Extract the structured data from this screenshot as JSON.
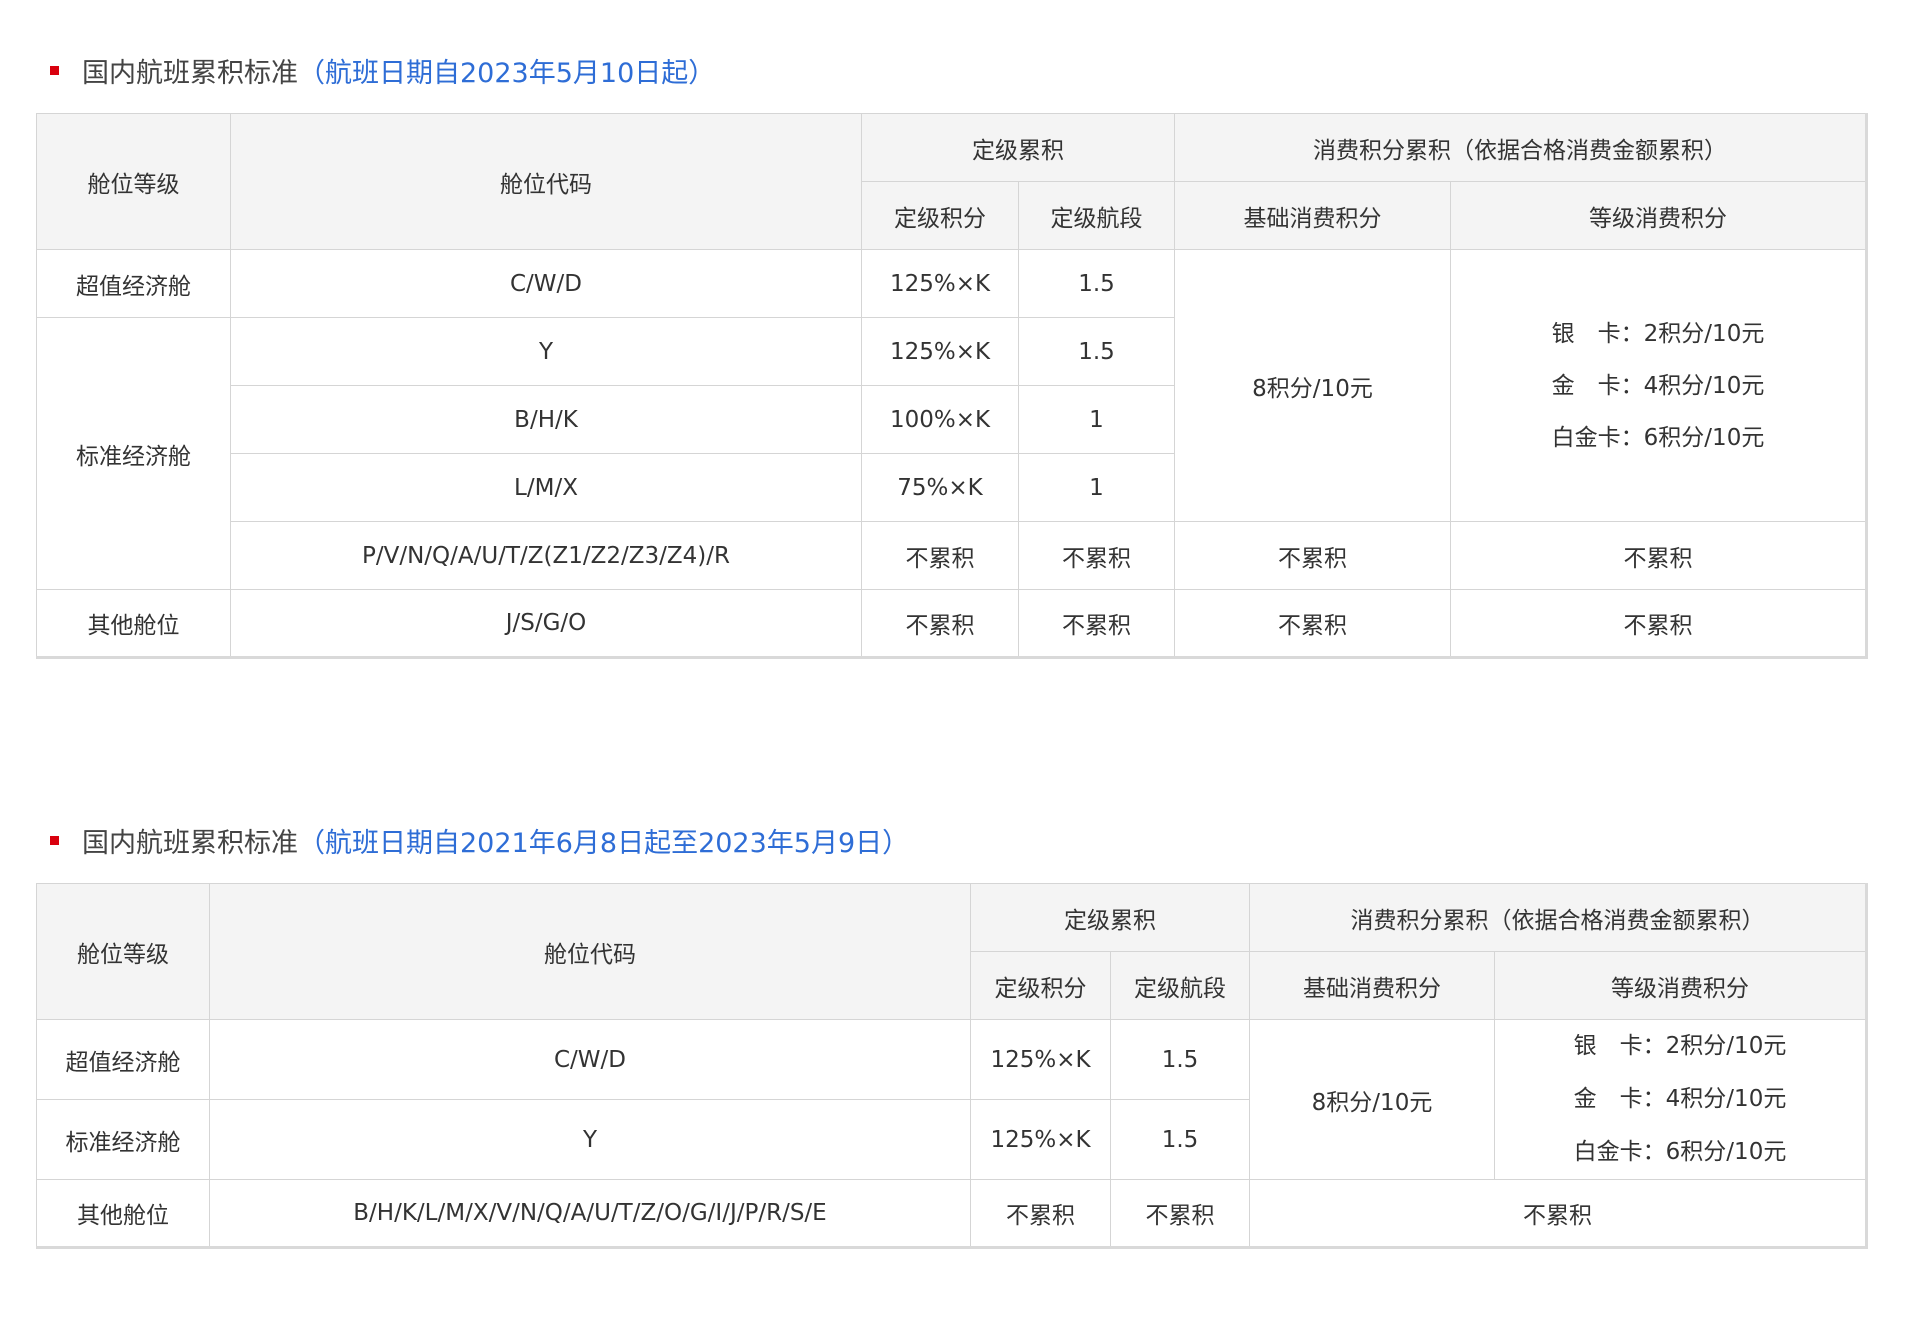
{
  "sections": [
    {
      "title": "国内航班累积标准",
      "subtitle": "（航班日期自2023年5月10日起）",
      "headers": {
        "cabin_class": "舱位等级",
        "cabin_code": "舱位代码",
        "grading_accrual": "定级累积",
        "spending_accrual": "消费积分累积（依据合格消费金额累积）",
        "grading_points": "定级积分",
        "grading_segments": "定级航段",
        "base_spending": "基础消费积分",
        "tier_spending": "等级消费积分"
      },
      "rows": [
        {
          "cabin_class": "超值经济舱",
          "code": "C/W/D",
          "grading_points": "125%×K",
          "segments": "1.5"
        },
        {
          "cabin_class": "标准经济舱",
          "code": "Y",
          "grading_points": "125%×K",
          "segments": "1.5"
        },
        {
          "code": "B/H/K",
          "grading_points": "100%×K",
          "segments": "1"
        },
        {
          "code": "L/M/X",
          "grading_points": "75%×K",
          "segments": "1"
        },
        {
          "code": "P/V/N/Q/A/U/T/Z(Z1/Z2/Z3/Z4)/R",
          "grading_points": "不累积",
          "segments": "不累积",
          "base": "不累积",
          "tier": "不累积"
        },
        {
          "cabin_class": "其他舱位",
          "code": "J/S/G/O",
          "grading_points": "不累积",
          "segments": "不累积",
          "base": "不累积",
          "tier": "不累积"
        }
      ],
      "base_points_merged": "8积分/10元",
      "tier_points": [
        "银　卡：2积分/10元",
        "金　卡：4积分/10元",
        "白金卡：6积分/10元"
      ]
    },
    {
      "title": "国内航班累积标准",
      "subtitle": "（航班日期自2021年6月8日起至2023年5月9日）",
      "headers": {
        "cabin_class": "舱位等级",
        "cabin_code": "舱位代码",
        "grading_accrual": "定级累积",
        "spending_accrual": "消费积分累积（依据合格消费金额累积）",
        "grading_points": "定级积分",
        "grading_segments": "定级航段",
        "base_spending": "基础消费积分",
        "tier_spending": "等级消费积分"
      },
      "rows": [
        {
          "cabin_class": "超值经济舱",
          "code": "C/W/D",
          "grading_points": "125%×K",
          "segments": "1.5"
        },
        {
          "cabin_class": "标准经济舱",
          "code": "Y",
          "grading_points": "125%×K",
          "segments": "1.5"
        },
        {
          "cabin_class": "其他舱位",
          "code": "B/H/K/L/M/X/V/N/Q/A/U/T/Z/O/G/I/J/P/R/S/E",
          "grading_points": "不累积",
          "segments": "不累积",
          "spending": "不累积"
        }
      ],
      "base_points_merged": "8积分/10元",
      "tier_points": [
        "银　卡：2积分/10元",
        "金　卡：4积分/10元",
        "白金卡：6积分/10元"
      ]
    }
  ]
}
